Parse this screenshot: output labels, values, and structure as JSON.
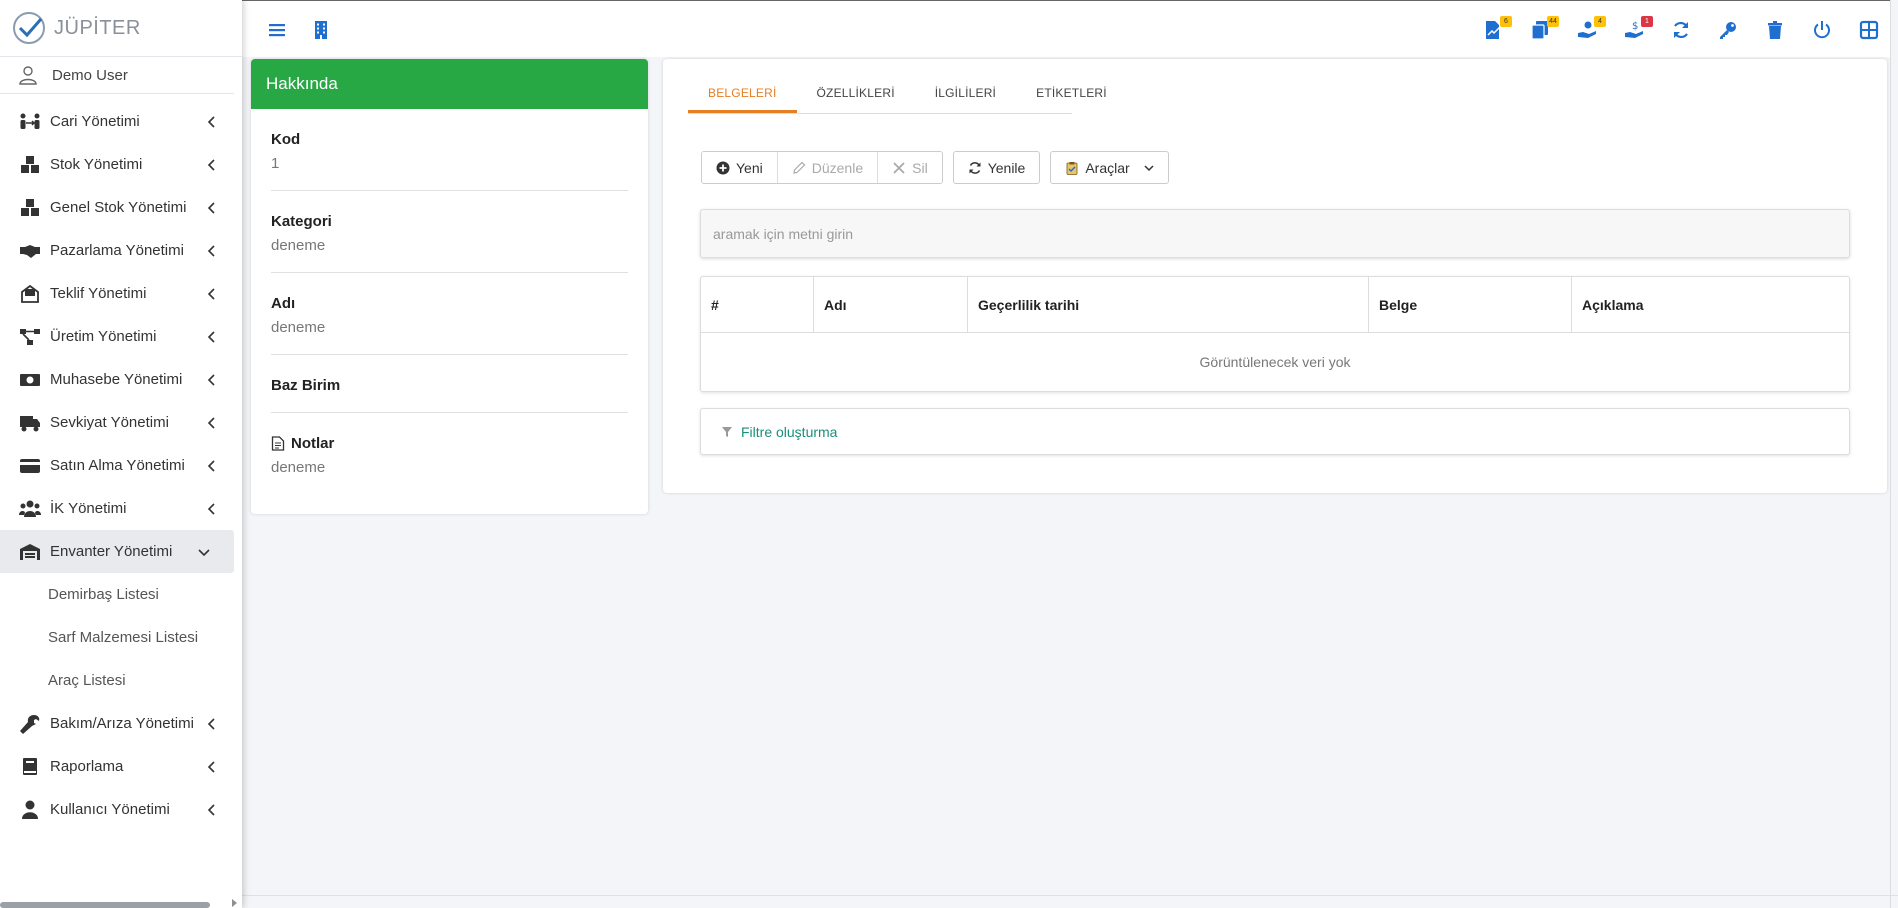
{
  "app": {
    "brand": "JÜPİTER"
  },
  "user": {
    "name": "Demo User"
  },
  "sidebar": {
    "items": [
      {
        "label": "Cari Yönetimi",
        "icon": "people-arrows-icon"
      },
      {
        "label": "Stok Yönetimi",
        "icon": "boxes-icon"
      },
      {
        "label": "Genel Stok Yönetimi",
        "icon": "boxes-icon"
      },
      {
        "label": "Pazarlama Yönetimi",
        "icon": "handshake-icon"
      },
      {
        "label": "Teklif Yönetimi",
        "icon": "envelope-open-icon"
      },
      {
        "label": "Üretim Yönetimi",
        "icon": "project-diagram-icon"
      },
      {
        "label": "Muhasebe Yönetimi",
        "icon": "money-bill-icon"
      },
      {
        "label": "Sevkiyat Yönetimi",
        "icon": "truck-icon"
      },
      {
        "label": "Satın Alma Yönetimi",
        "icon": "credit-card-icon"
      },
      {
        "label": "İK Yönetimi",
        "icon": "users-icon"
      },
      {
        "label": "Envanter Yönetimi",
        "icon": "warehouse-icon"
      }
    ],
    "submenu": [
      {
        "label": "Demirbaş Listesi"
      },
      {
        "label": "Sarf Malzemesi Listesi"
      },
      {
        "label": "Araç Listesi"
      }
    ],
    "items_after": [
      {
        "label": "Bakım/Arıza Yönetimi",
        "icon": "wrench-icon"
      },
      {
        "label": "Raporlama",
        "icon": "book-icon"
      },
      {
        "label": "Kullanıcı Yönetimi",
        "icon": "user-icon"
      }
    ]
  },
  "topbar": {
    "badges": [
      "6",
      "44",
      "4",
      "1"
    ]
  },
  "about": {
    "title": "Hakkında",
    "fields": [
      {
        "label": "Kod",
        "value": "1"
      },
      {
        "label": "Kategori",
        "value": "deneme"
      },
      {
        "label": "Adı",
        "value": "deneme"
      },
      {
        "label": "Baz Birim",
        "value": ""
      },
      {
        "label": "Notlar",
        "value": "deneme"
      }
    ]
  },
  "main": {
    "tabs": [
      "BELGELERİ",
      "ÖZELLİKLERİ",
      "İLGİLİLERİ",
      "ETİKETLERİ"
    ],
    "toolbar": {
      "new": "Yeni",
      "edit": "Düzenle",
      "delete": "Sil",
      "refresh": "Yenile",
      "tools": "Araçlar"
    },
    "search_placeholder": "aramak için metni girin",
    "columns": [
      "#",
      "Adı",
      "Geçerlilik tarihi",
      "Belge",
      "Açıklama"
    ],
    "empty_text": "Görüntülenecek veri yok",
    "filter_label": "Filtre oluşturma"
  },
  "colors": {
    "accent": "#1e6fd0",
    "header_green": "#28a745",
    "tab_active": "#e67e22",
    "filter_link": "#1a8f7a"
  }
}
